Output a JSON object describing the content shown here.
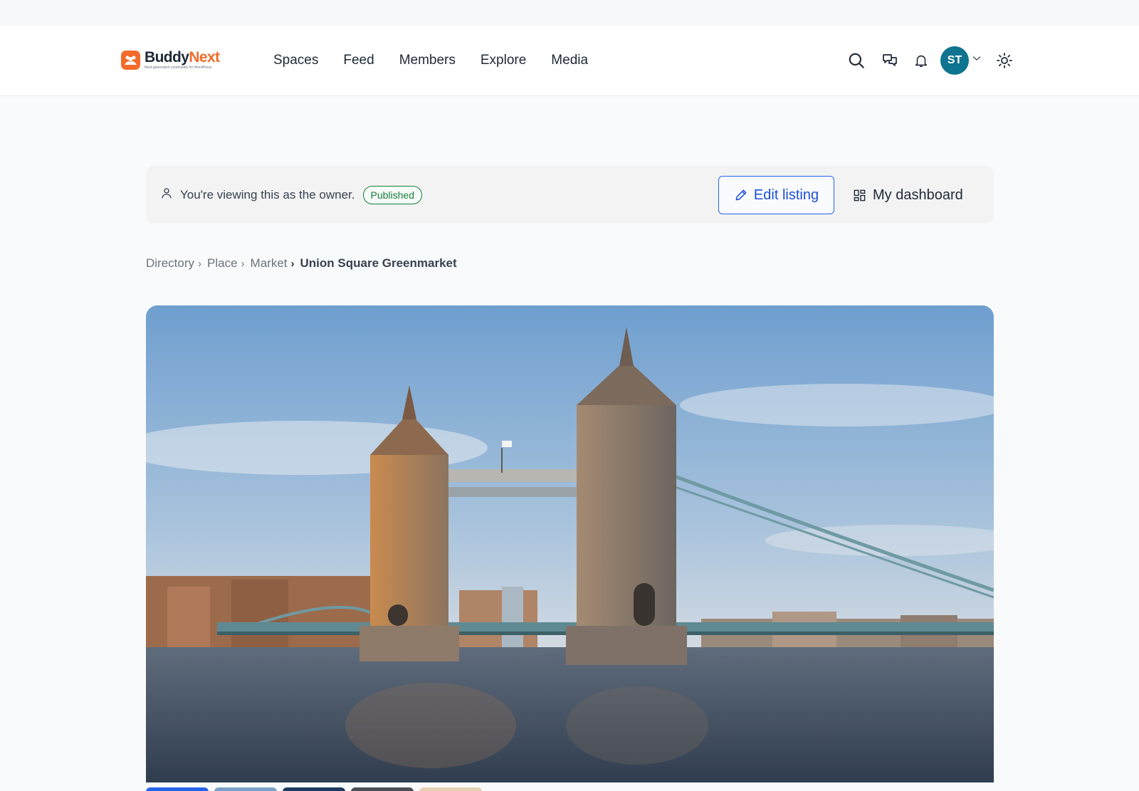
{
  "brand": {
    "name_part1": "Buddy",
    "name_part2": "Next",
    "tagline": "Next-generation community for WordPress",
    "accent": "#f26b2a"
  },
  "nav": {
    "items": [
      {
        "label": "Spaces"
      },
      {
        "label": "Feed"
      },
      {
        "label": "Members"
      },
      {
        "label": "Explore"
      },
      {
        "label": "Media"
      }
    ]
  },
  "header_actions": {
    "icons": [
      "search-icon",
      "messages-icon",
      "bell-icon",
      "chevron-down-icon",
      "sun-icon"
    ],
    "avatar_initials": "ST",
    "avatar_color": "#0e7490"
  },
  "owner_bar": {
    "message": "You're viewing this as the owner.",
    "status": "Published",
    "status_color": "#15803d",
    "edit_label": "Edit listing",
    "dashboard_label": "My dashboard"
  },
  "breadcrumb": {
    "items": [
      "Directory",
      "Place",
      "Market"
    ],
    "current": "Union Square Greenmarket"
  },
  "gallery": {
    "hero_icon": "photo-tower-bridge",
    "thumb_colors": [
      "#2563eb",
      "#7aa1c8",
      "#1e3a5f",
      "#4b4f58",
      "#e8d2b4"
    ],
    "selected_index": 0
  }
}
